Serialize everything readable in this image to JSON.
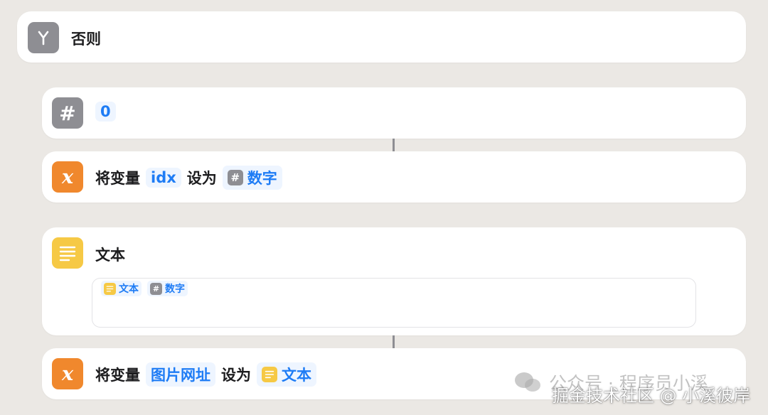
{
  "otherwise": {
    "title": "否则",
    "icon": "branch-icon"
  },
  "number_action": {
    "value": "0",
    "icon": "hash-icon"
  },
  "set_var1": {
    "label": "将变量",
    "var_name": "idx",
    "set_to": "设为",
    "value_label": "数字",
    "icon": "variable-x-icon"
  },
  "text_action": {
    "title": "文本",
    "icon": "text-lines-icon",
    "content": {
      "text_token": "文本",
      "number_token": "数字"
    }
  },
  "set_var2": {
    "label": "将变量",
    "var_name": "图片网址",
    "set_to": "设为",
    "value_label": "文本",
    "icon": "variable-x-icon"
  },
  "watermark": {
    "line1": "公众号 · 程序员小溪",
    "line2": "掘金技术社区 @ 小溪彼岸"
  },
  "colors": {
    "accent": "#1e7cf5",
    "orange": "#f0882d",
    "yellow": "#f6c945",
    "gray": "#8e8e93"
  }
}
